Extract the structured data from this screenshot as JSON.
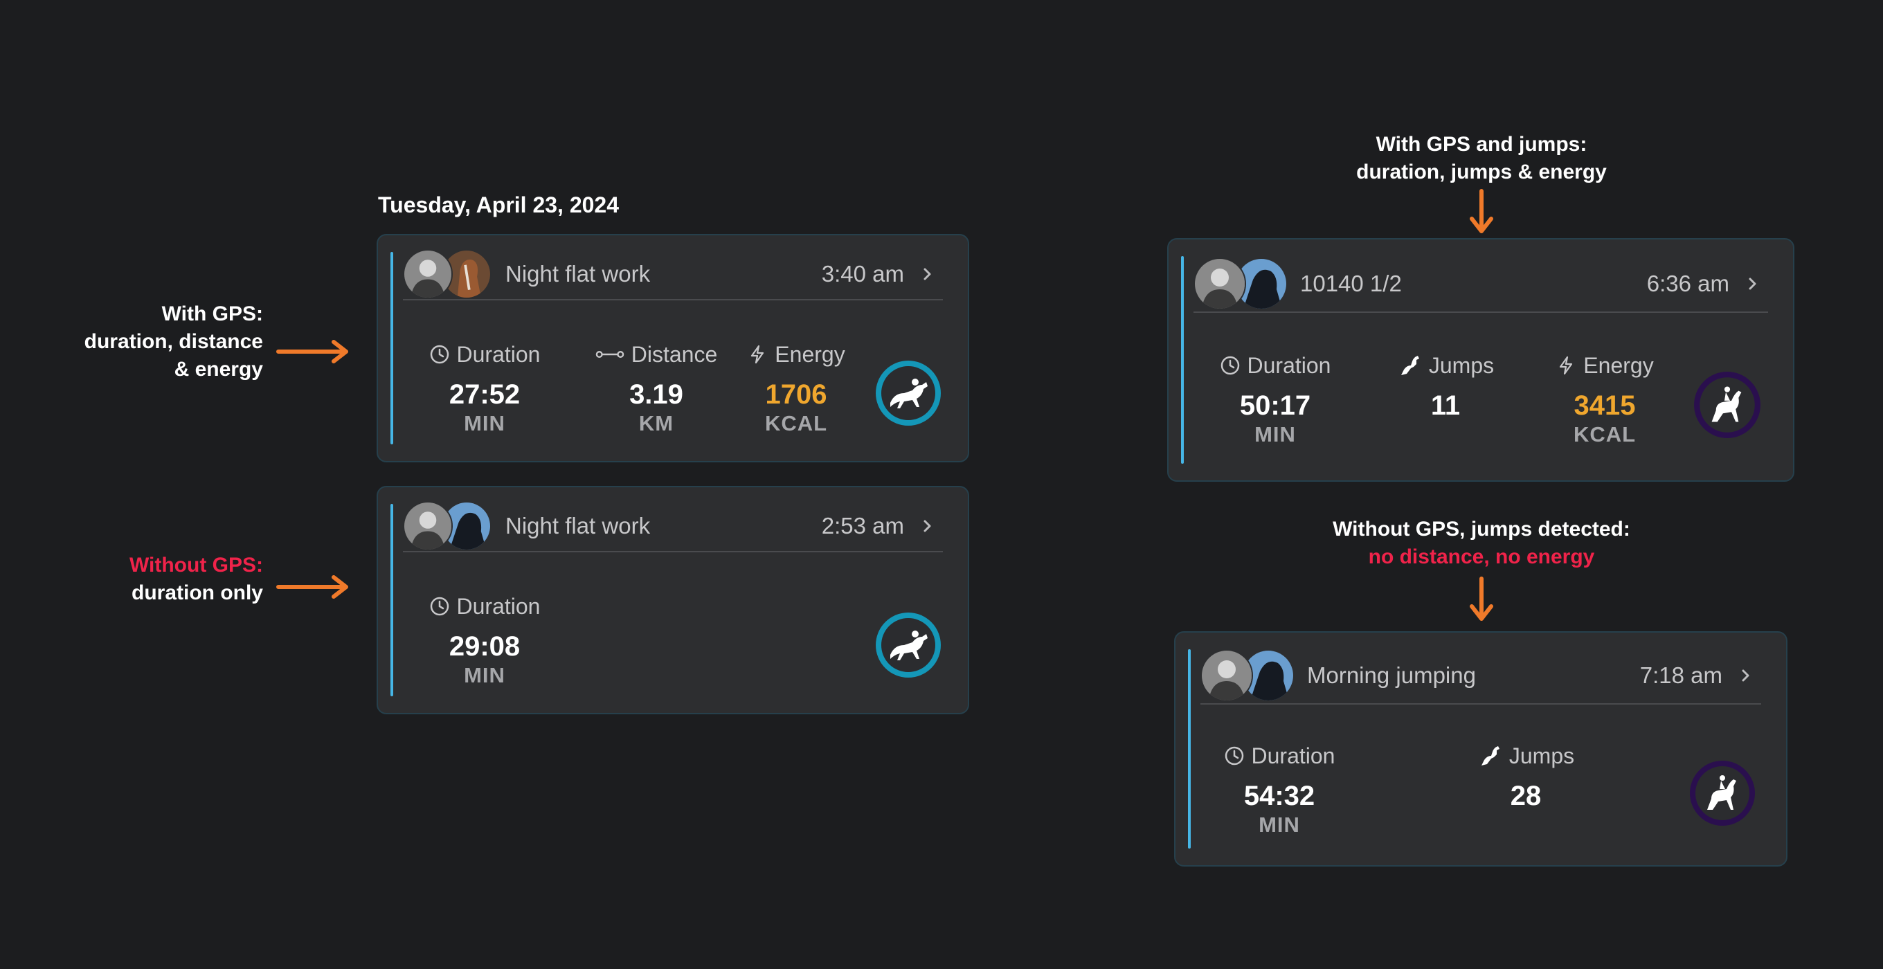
{
  "annotations": {
    "gps": [
      "With GPS:",
      "duration, distance",
      "& energy"
    ],
    "no_gps_red": "Without GPS:",
    "no_gps": "duration only",
    "gps_jumps": [
      "With GPS and jumps:",
      "duration, jumps & energy"
    ],
    "no_gps_jumps": "Without GPS, jumps detected:",
    "no_gps_jumps_red": "no distance, no energy"
  },
  "date_header": "Tuesday, April 23, 2024",
  "cards": [
    {
      "title": "Night flat work",
      "time": "3:40 am",
      "badge": "gallop-badge",
      "stats": [
        {
          "icon": "clock-icon",
          "label": "Duration",
          "value": "27:52",
          "unit": "MIN"
        },
        {
          "icon": "distance-icon",
          "label": "Distance",
          "value": "3.19",
          "unit": "KM"
        },
        {
          "icon": "lightning-icon",
          "label": "Energy",
          "value": "1706",
          "unit": "KCAL"
        }
      ]
    },
    {
      "title": "Night flat work",
      "time": "2:53 am",
      "badge": "gallop-badge",
      "stats": [
        {
          "icon": "clock-icon",
          "label": "Duration",
          "value": "29:08",
          "unit": "MIN"
        }
      ]
    },
    {
      "title": "10140 1/2",
      "time": "6:36 am",
      "badge": "dressage-badge",
      "stats": [
        {
          "icon": "clock-icon",
          "label": "Duration",
          "value": "50:17",
          "unit": "MIN"
        },
        {
          "icon": "jump-horse-icon",
          "label": "Jumps",
          "value": "11",
          "unit": ""
        },
        {
          "icon": "lightning-icon",
          "label": "Energy",
          "value": "3415",
          "unit": "KCAL"
        }
      ]
    },
    {
      "title": "Morning jumping",
      "time": "7:18 am",
      "badge": "dressage-badge",
      "stats": [
        {
          "icon": "clock-icon",
          "label": "Duration",
          "value": "54:32",
          "unit": "MIN"
        },
        {
          "icon": "jump-horse-icon",
          "label": "Jumps",
          "value": "28",
          "unit": ""
        }
      ]
    }
  ],
  "colors": {
    "background": "#1c1d1f",
    "card": "#2d2e30",
    "accent_bar": "#46b6e6",
    "energy": "#f0a72e",
    "arrow": "#f07a2a",
    "warning": "#f0234a",
    "gallop_ring": "#1497b8",
    "dressage_ring": "#2a0f4e"
  }
}
